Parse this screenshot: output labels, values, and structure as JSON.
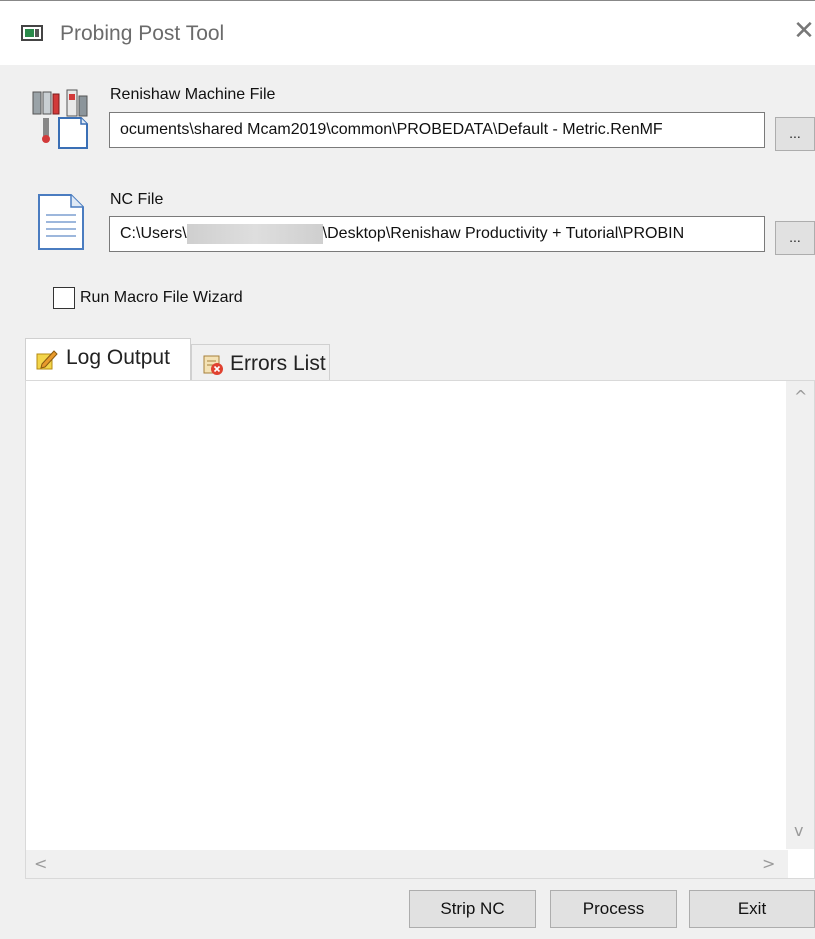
{
  "window": {
    "title": "Probing Post Tool",
    "close_glyph": "✕"
  },
  "machine_file": {
    "label": "Renishaw Machine File",
    "value": "ocuments\\shared Mcam2019\\common\\PROBEDATA\\Default - Metric.RenMF",
    "browse_label": "..."
  },
  "nc_file": {
    "label": "NC File",
    "value_prefix": "C:\\Users\\",
    "value_suffix": "\\Desktop\\Renishaw Productivity + Tutorial\\PROBIN",
    "browse_label": "..."
  },
  "wizard": {
    "label": "Run Macro File Wizard",
    "checked": false
  },
  "tabs": [
    {
      "label": "Log Output",
      "icon": "pencil-note-icon",
      "active": true
    },
    {
      "label": "Errors List",
      "icon": "error-list-icon",
      "active": false
    }
  ],
  "log_output": "",
  "scrollbar": {
    "up": "^",
    "down": "v",
    "left": "<",
    "right": ">"
  },
  "buttons": {
    "strip_nc": "Strip NC",
    "process": "Process",
    "exit": "Exit"
  }
}
